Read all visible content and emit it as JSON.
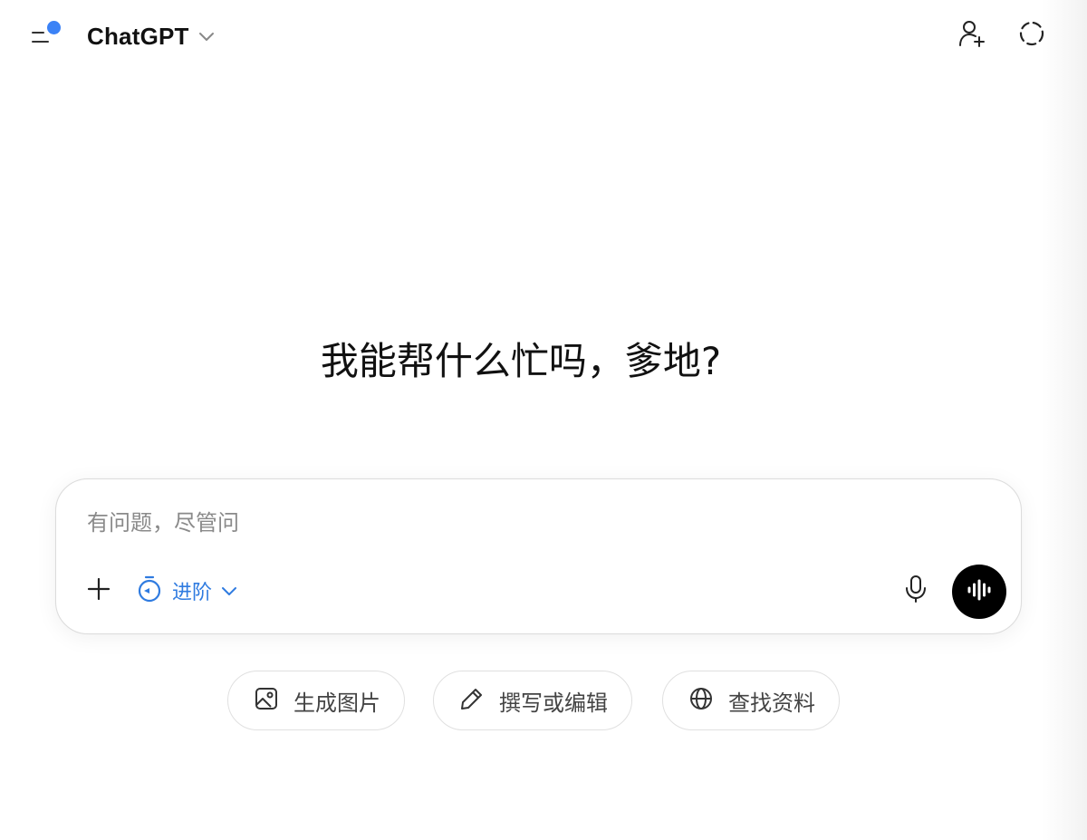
{
  "header": {
    "model_name": "ChatGPT",
    "icons": {
      "sidebar": "sidebar-toggle-icon",
      "model_dropdown": "chevron-down-icon",
      "share": "add-person-icon",
      "temporary_chat": "temporary-chat-icon"
    }
  },
  "hero": {
    "greeting": "我能帮什么忙吗，爹地?"
  },
  "composer": {
    "placeholder": "有问题，尽管问",
    "mode_label": "进阶",
    "icons": {
      "attach": "plus-icon",
      "mode": "timer-icon",
      "mode_dropdown": "chevron-down-icon",
      "mic": "microphone-icon",
      "voice": "voice-waveform-icon"
    }
  },
  "suggestions": [
    {
      "label": "生成图片",
      "icon": "image-icon"
    },
    {
      "label": "撰写或编辑",
      "icon": "pencil-icon"
    },
    {
      "label": "查找资料",
      "icon": "globe-icon"
    }
  ],
  "colors": {
    "accent_blue": "#3b82f6",
    "mode_blue": "#2f7be0",
    "voice_button": "#000000"
  }
}
